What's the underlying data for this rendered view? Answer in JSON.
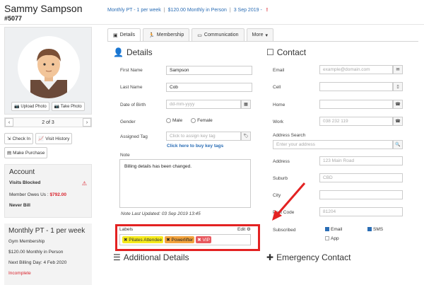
{
  "member": {
    "name": "Sammy Sampson",
    "id": "#5077"
  },
  "summary": {
    "plan": "Monthly PT - 1 per week",
    "price": "$120.00 Monthly in Person",
    "date": "3 Sep 2019 -",
    "alert": "!"
  },
  "photo": {
    "upload_label": "Upload Photo",
    "take_label": "Take Photo"
  },
  "pager": {
    "text": "2 of 3"
  },
  "actions": {
    "check_in": "Check In",
    "visit_history": "Visit History",
    "make_purchase": "Make Purchase"
  },
  "account": {
    "title": "Account",
    "visits_blocked": "Visits Blocked",
    "owes_label": "Member Owes Us :",
    "owes_value": "$792.00",
    "never_bill": "Never Bill"
  },
  "membership_panel": {
    "title": "Monthly PT - 1 per week",
    "type": "Gym Membership",
    "price": "$120.00 Monthly in Person",
    "next_billing": "Next Billing Day: 4 Feb 2020",
    "status": "Incomplete"
  },
  "tabs": [
    {
      "label": "Details"
    },
    {
      "label": "Membership"
    },
    {
      "label": "Communication"
    },
    {
      "label": "More"
    }
  ],
  "details": {
    "title": "Details",
    "first_name_label": "First Name",
    "first_name": "Sampson",
    "last_name_label": "Last Name",
    "last_name": "Cob",
    "dob_label": "Date of Birth",
    "dob_placeholder": "dd-mm-yyyy",
    "gender_label": "Gender",
    "gender_male": "Male",
    "gender_female": "Female",
    "tag_label": "Assigned Tag",
    "tag_placeholder": "Click to assign key tag",
    "buy_tags_link": "Click here to buy key tags",
    "note_label": "Note",
    "note_text": "Billing details has been changed.",
    "note_meta": "Note Last Updated: 03 Sep 2019 13:45",
    "labels_label": "Labels",
    "labels_edit": "Edit",
    "labels": [
      "Pilates Attendee",
      "Powerlifter",
      "VIP"
    ]
  },
  "contact": {
    "title": "Contact",
    "email_label": "Email",
    "email_placeholder": "example@domain.com",
    "cell_label": "Cell",
    "home_label": "Home",
    "work_label": "Work",
    "work_value": "038 232 119",
    "address_search_label": "Address Search",
    "address_search_placeholder": "Enter your address",
    "address_label": "Address",
    "address_value": "123 Main Road",
    "suburb_label": "Suburb",
    "suburb_value": "CBD",
    "city_label": "City",
    "postcode_label": "Post Code",
    "postcode_value": "81204",
    "subscribed_label": "Subscribed",
    "sub_email": "Email",
    "sub_sms": "SMS",
    "sub_app": "App"
  },
  "bottom": {
    "additional": "Additional Details",
    "emergency": "Emergency Contact"
  },
  "colors": {
    "accent": "#2a6db5",
    "alert": "#d9232d",
    "highlight": "#e32222"
  }
}
